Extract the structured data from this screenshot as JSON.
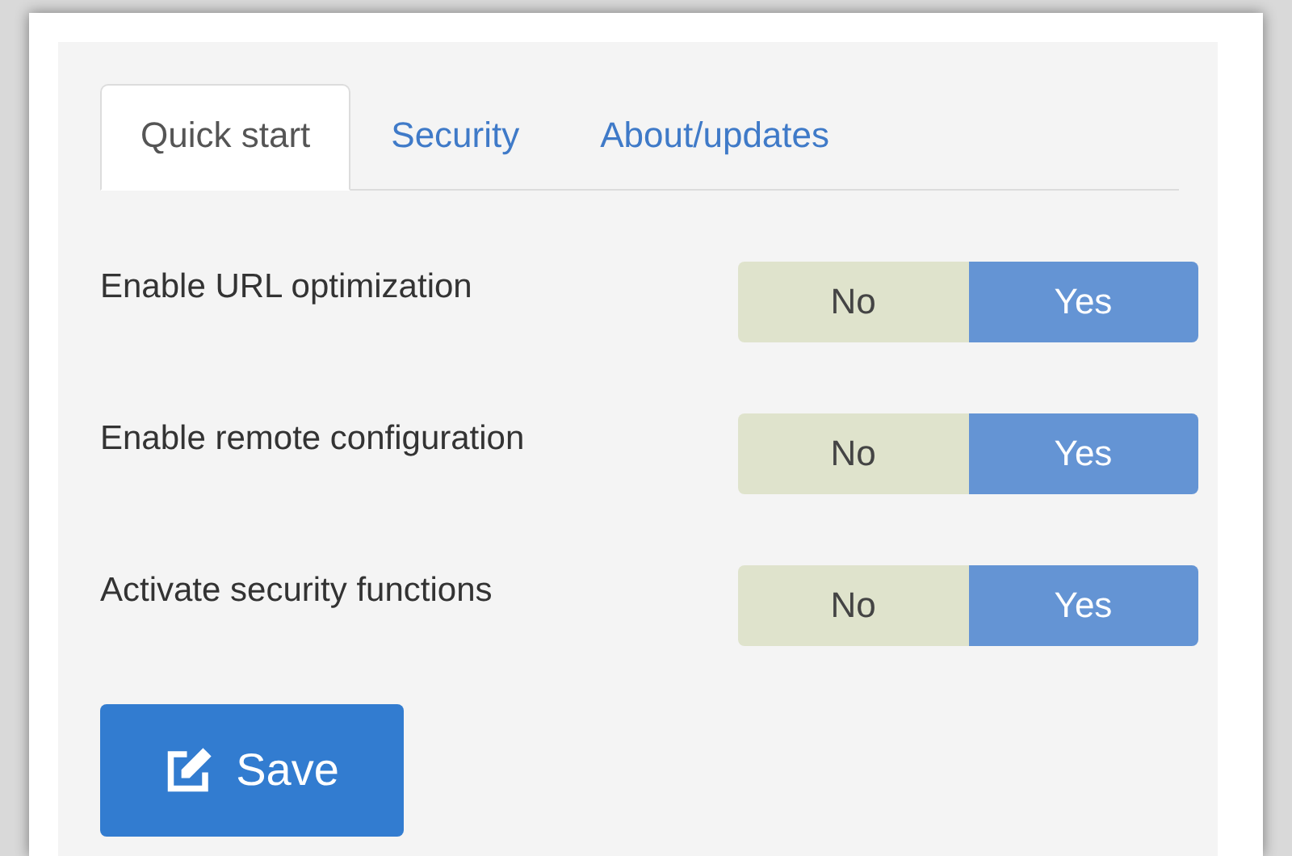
{
  "tabs": [
    {
      "label": "Quick start",
      "selected": true
    },
    {
      "label": "Security",
      "selected": false
    },
    {
      "label": "About/updates",
      "selected": false
    }
  ],
  "settings": [
    {
      "label": "Enable URL optimization",
      "options": [
        {
          "label": "No",
          "selected": false
        },
        {
          "label": "Yes",
          "selected": true
        }
      ]
    },
    {
      "label": "Enable remote configuration",
      "options": [
        {
          "label": "No",
          "selected": false
        },
        {
          "label": "Yes",
          "selected": true
        }
      ]
    },
    {
      "label": "Activate security functions",
      "options": [
        {
          "label": "No",
          "selected": false
        },
        {
          "label": "Yes",
          "selected": true
        }
      ]
    }
  ],
  "save_button": {
    "label": "Save"
  }
}
